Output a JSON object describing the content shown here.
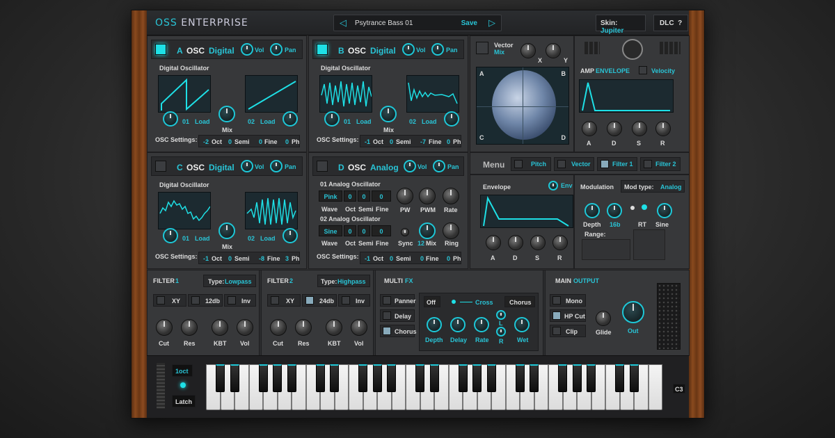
{
  "header": {
    "logo_a": "OSS",
    "logo_b": "ENTERPRISE",
    "preset_name": "Psytrance Bass 01",
    "save_label": "Save",
    "skin_label": "Skin:",
    "skin_value": "Jupiter",
    "dlc_label": "DLC",
    "help_label": "?"
  },
  "osc_a": {
    "letter": "A",
    "title": "OSC",
    "type": "Digital",
    "vol": "Vol",
    "pan": "Pan",
    "subtitle": "Digital Oscillator",
    "slot1": "01",
    "load1": "Load",
    "mix": "Mix",
    "slot2": "02",
    "load2": "Load",
    "settings_label": "OSC Settings:",
    "oct": "-2",
    "oct_l": "Oct",
    "semi": "0",
    "semi_l": "Semi",
    "fine": "0",
    "fine_l": "Fine",
    "ph": "0",
    "ph_l": "Ph"
  },
  "osc_b": {
    "letter": "B",
    "title": "OSC",
    "type": "Digital",
    "vol": "Vol",
    "pan": "Pan",
    "subtitle": "Digital Oscillator",
    "slot1": "01",
    "load1": "Load",
    "mix": "Mix",
    "slot2": "02",
    "load2": "Load",
    "settings_label": "OSC Settings:",
    "oct": "-1",
    "oct_l": "Oct",
    "semi": "0",
    "semi_l": "Semi",
    "fine": "-7",
    "fine_l": "Fine",
    "ph": "0",
    "ph_l": "Ph"
  },
  "osc_c": {
    "letter": "C",
    "title": "OSC",
    "type": "Digital",
    "vol": "Vol",
    "pan": "Pan",
    "subtitle": "Digital Oscillator",
    "slot1": "01",
    "load1": "Load",
    "mix": "Mix",
    "slot2": "02",
    "load2": "Load",
    "settings_label": "OSC Settings:",
    "oct": "-1",
    "oct_l": "Oct",
    "semi": "0",
    "semi_l": "Semi",
    "fine": "-8",
    "fine_l": "Fine",
    "ph": "3",
    "ph_l": "Ph"
  },
  "osc_d": {
    "letter": "D",
    "title": "OSC",
    "type": "Analog",
    "vol": "Vol",
    "pan": "Pan",
    "a1_title": "01 Analog Oscillator",
    "a1_wave": "Pink",
    "a1_oct": "0",
    "a1_semi": "0",
    "a1_fine": "0",
    "a2_title": "02 Analog Oscillator",
    "a2_wave": "Sine",
    "a2_oct": "0",
    "a2_semi": "0",
    "a2_fine": "0",
    "wave_l": "Wave",
    "oct_l": "Oct",
    "semi_l": "Semi",
    "fine_l": "Fine",
    "pw": "PW",
    "pwm": "PWM",
    "rate": "Rate",
    "sync": "Sync",
    "mix_val": "12",
    "mix": "Mix",
    "ring": "Ring",
    "settings_label": "OSC Settings:",
    "oct": "-1",
    "semi": "0",
    "fine": "0",
    "ph": "0",
    "ph_l": "Ph"
  },
  "vector": {
    "title": "Vector",
    "mix": "Mix",
    "x": "X",
    "y": "Y",
    "corner_a": "A",
    "corner_b": "B",
    "corner_c": "C",
    "corner_d": "D"
  },
  "amp": {
    "title": "AMP",
    "env": "ENVELOPE",
    "velocity": "Velocity",
    "a": "A",
    "d": "D",
    "s": "S",
    "r": "R"
  },
  "menu": {
    "label": "Menu",
    "pitch": "Pitch",
    "vector": "Vector",
    "filter1": "Filter 1",
    "filter2": "Filter 2"
  },
  "envelope": {
    "title": "Envelope",
    "env": "Env",
    "a": "A",
    "d": "D",
    "s": "S",
    "r": "R"
  },
  "modulation": {
    "title": "Modulation",
    "type_label": "Mod type:",
    "type_value": "Analog",
    "depth": "Depth",
    "val16b": "16b",
    "rt": "RT",
    "sine": "Sine",
    "range": "Range:"
  },
  "filter1": {
    "title": "FILTER",
    "num": "1",
    "type_label": "Type:",
    "type_value": "Lowpass",
    "xy": "XY",
    "db": "12db",
    "inv": "Inv",
    "cut": "Cut",
    "res": "Res",
    "kbt": "KBT",
    "vol": "Vol"
  },
  "filter2": {
    "title": "FILTER",
    "num": "2",
    "type_label": "Type:",
    "type_value": "Highpass",
    "xy": "XY",
    "db": "24db",
    "inv": "Inv",
    "cut": "Cut",
    "res": "Res",
    "kbt": "KBT",
    "vol": "Vol"
  },
  "multifx": {
    "title": "MULTI",
    "fx": "FX",
    "panner": "Panner",
    "delay": "Delay",
    "chorus": "Chorus",
    "off": "Off",
    "cross": "Cross",
    "mode": "Chorus",
    "depth": "Depth",
    "delay_k": "Delay",
    "rate": "Rate",
    "l": "L",
    "r": "R",
    "wet": "Wet"
  },
  "output": {
    "title": "MAIN",
    "out": "OUTPUT",
    "mono": "Mono",
    "hpcut": "HP Cut",
    "clip": "Clip",
    "glide": "Glide",
    "out_k": "Out"
  },
  "keyboard": {
    "oct": "1oct",
    "latch": "Latch",
    "note": "C3"
  },
  "colors": {
    "accent": "#29c4d6",
    "panel": "#37383a",
    "wood": "#7a3f18"
  }
}
